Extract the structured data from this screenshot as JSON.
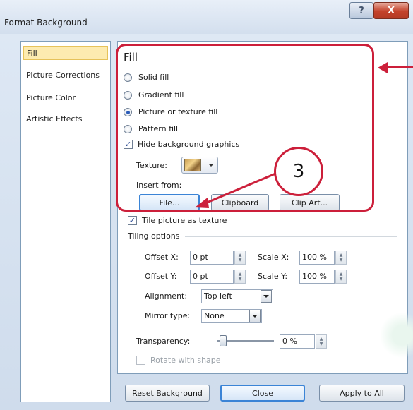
{
  "window": {
    "title": "Format Background",
    "help_label": "?",
    "close_label": "X"
  },
  "sidebar": {
    "items": [
      {
        "label": "Fill",
        "selected": true
      },
      {
        "label": "Picture Corrections"
      },
      {
        "label": "Picture Color"
      },
      {
        "label": "Artistic Effects"
      }
    ]
  },
  "fill": {
    "title": "Fill",
    "options": [
      {
        "label": "Solid fill",
        "checked": false
      },
      {
        "label": "Gradient fill",
        "checked": false
      },
      {
        "label": "Picture or texture fill",
        "checked": true
      },
      {
        "label": "Pattern fill",
        "checked": false
      }
    ],
    "hide_background": {
      "label": "Hide background graphics",
      "checked": true
    },
    "texture_label": "Texture:",
    "insert_from_label": "Insert from:",
    "file_button": "File...",
    "clipboard_button": "Clipboard",
    "clipart_button": "Clip Art...",
    "callout_number": "3"
  },
  "tile": {
    "checkbox_label": "Tile picture as texture",
    "checked": true,
    "section_title": "Tiling options",
    "offset_x_label": "Offset X:",
    "offset_x_value": "0 pt",
    "offset_y_label": "Offset Y:",
    "offset_y_value": "0 pt",
    "scale_x_label": "Scale X:",
    "scale_x_value": "100 %",
    "scale_y_label": "Scale Y:",
    "scale_y_value": "100 %",
    "alignment_label": "Alignment:",
    "alignment_value": "Top left",
    "mirror_label": "Mirror type:",
    "mirror_value": "None",
    "transparency_label": "Transparency:",
    "transparency_value": "0 %",
    "transparency_level": 0,
    "rotate_label": "Rotate with shape",
    "rotate_checked": false
  },
  "footer": {
    "reset_label": "Reset Background",
    "close_label": "Close",
    "apply_label": "Apply to All"
  },
  "colors": {
    "highlight": "#cc1f3a",
    "selected_item": "#fdebb0"
  }
}
